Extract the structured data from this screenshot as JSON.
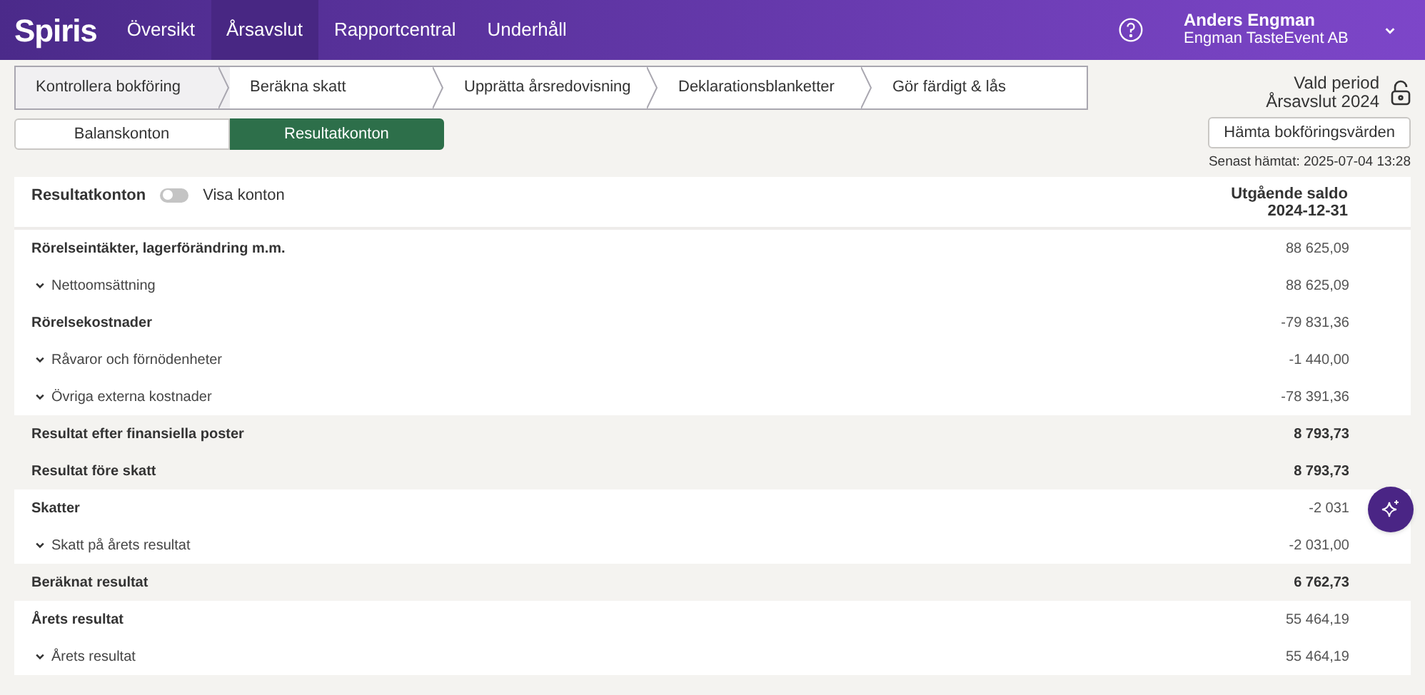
{
  "nav": {
    "logo": "Spiris",
    "items": [
      {
        "label": "Översikt",
        "selected": false
      },
      {
        "label": "Årsavslut",
        "selected": true
      },
      {
        "label": "Rapportcentral",
        "selected": false
      },
      {
        "label": "Underhåll",
        "selected": false
      }
    ],
    "user": {
      "name": "Anders Engman",
      "company": "Engman TasteEvent AB"
    }
  },
  "steps": [
    {
      "label": "Kontrollera bokföring",
      "selected": true
    },
    {
      "label": "Beräkna skatt",
      "selected": false
    },
    {
      "label": "Upprätta årsredovisning",
      "selected": false
    },
    {
      "label": "Deklarationsblanketter",
      "selected": false
    },
    {
      "label": "Gör färdigt & lås",
      "selected": false
    }
  ],
  "period": {
    "label": "Vald period",
    "value": "Årsavslut 2024",
    "fetch_button": "Hämta bokföringsvärden",
    "last_fetched": "Senast hämtat: 2025-07-04 13:28"
  },
  "tabs": [
    {
      "label": "Balanskonton",
      "selected": false
    },
    {
      "label": "Resultatkonton",
      "selected": true
    }
  ],
  "table": {
    "title": "Resultatkonton",
    "toggle": {
      "label": "Visa konton",
      "on": false
    },
    "column_header": [
      "Utgående saldo",
      "2024-12-31"
    ],
    "rows": [
      {
        "kind": "group",
        "label": "Rörelseintäkter, lagerförändring m.m.",
        "value": "88 625,09"
      },
      {
        "kind": "sub",
        "label": "Nettoomsättning",
        "value": "88 625,09",
        "expanded": false
      },
      {
        "kind": "group",
        "label": "Rörelsekostnader",
        "value": "-79 831,36"
      },
      {
        "kind": "sub",
        "label": "Råvaror och förnödenheter",
        "value": "-1 440,00",
        "expanded": false
      },
      {
        "kind": "sub",
        "label": "Övriga externa kostnader",
        "value": "-78 391,36",
        "expanded": false
      },
      {
        "kind": "total",
        "label": "Resultat efter finansiella poster",
        "value": "8 793,73"
      },
      {
        "kind": "total",
        "label": "Resultat före skatt",
        "value": "8 793,73"
      },
      {
        "kind": "group",
        "label": "Skatter",
        "value": "-2 031"
      },
      {
        "kind": "sub",
        "label": "Skatt på årets resultat",
        "value": "-2 031,00",
        "expanded": false
      },
      {
        "kind": "total",
        "label": "Beräknat resultat",
        "value": "6 762,73"
      },
      {
        "kind": "group",
        "label": "Årets resultat",
        "value": "55 464,19"
      },
      {
        "kind": "sub",
        "label": "Årets resultat",
        "value": "55 464,19",
        "expanded": false
      }
    ]
  }
}
